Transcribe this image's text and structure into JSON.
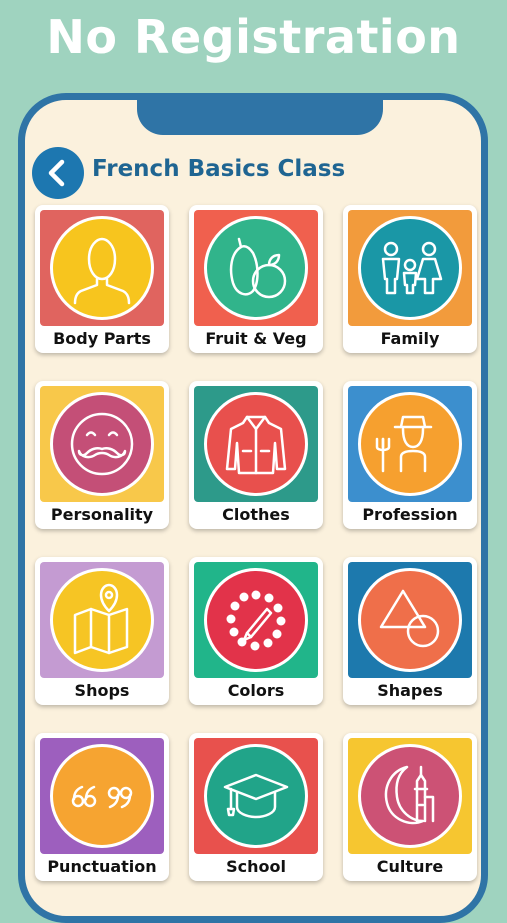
{
  "banner": {
    "headline": "No Registration"
  },
  "header": {
    "title": "French Basics Class",
    "back_icon": "chevron-left-icon"
  },
  "categories": [
    {
      "label": "Body Parts",
      "icon": "person-icon",
      "tile_color": "#e0645f",
      "circle_color": "#f7c51e"
    },
    {
      "label": "Fruit & Veg",
      "icon": "fruit-icon",
      "tile_color": "#f0604e",
      "circle_color": "#31b48b"
    },
    {
      "label": "Family",
      "icon": "family-icon",
      "tile_color": "#f29b3c",
      "circle_color": "#1a97a6"
    },
    {
      "label": "Personality",
      "icon": "mustache-face-icon",
      "tile_color": "#f8c84a",
      "circle_color": "#c44f77"
    },
    {
      "label": "Clothes",
      "icon": "jacket-icon",
      "tile_color": "#2d9a8a",
      "circle_color": "#e8504d"
    },
    {
      "label": "Profession",
      "icon": "farmer-icon",
      "tile_color": "#3c8fce",
      "circle_color": "#f6a02f"
    },
    {
      "label": "Shops",
      "icon": "map-pin-icon",
      "tile_color": "#c49bd2",
      "circle_color": "#f6c524"
    },
    {
      "label": "Colors",
      "icon": "palette-icon",
      "tile_color": "#21b58a",
      "circle_color": "#e2334a"
    },
    {
      "label": "Shapes",
      "icon": "shapes-icon",
      "tile_color": "#1d79ad",
      "circle_color": "#ef6f4a"
    },
    {
      "label": "Punctuation",
      "icon": "quote-marks-icon",
      "tile_color": "#9d5fbe",
      "circle_color": "#f6a431"
    },
    {
      "label": "School",
      "icon": "graduation-cap-icon",
      "tile_color": "#e8514d",
      "circle_color": "#21a489"
    },
    {
      "label": "Culture",
      "icon": "crescent-tower-icon",
      "tile_color": "#f6c630",
      "circle_color": "#cc5275"
    }
  ]
}
